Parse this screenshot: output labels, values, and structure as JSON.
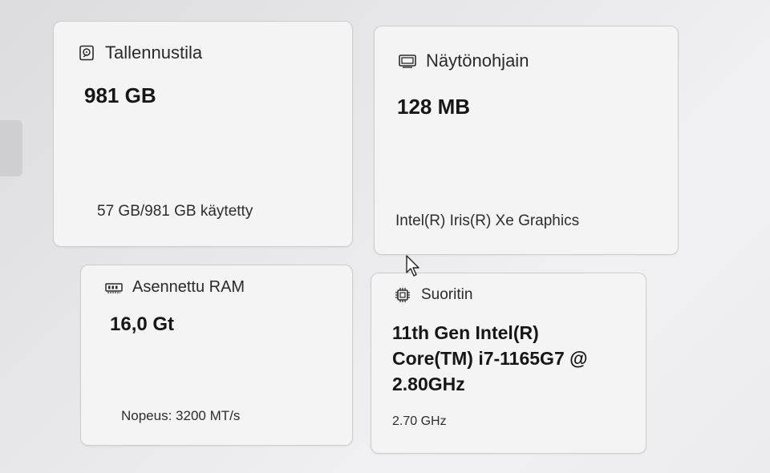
{
  "cards": {
    "storage": {
      "icon": "drive-icon",
      "title": "Tallennustila",
      "value": "981 GB",
      "detail": "57 GB/981 GB käytetty"
    },
    "gpu": {
      "icon": "display-adapter-icon",
      "title": "Näytönohjain",
      "value": "128 MB",
      "detail": "Intel(R) Iris(R) Xe Graphics"
    },
    "ram": {
      "icon": "ram-icon",
      "title": "Asennettu RAM",
      "value": "16,0 Gt",
      "detail": "Nopeus: 3200 MT/s"
    },
    "cpu": {
      "icon": "processor-icon",
      "title": "Suoritin",
      "value_lines": [
        "11th Gen Intel(R)",
        "Core(TM) i7-1165G7 @",
        "2.80GHz"
      ],
      "detail": "2.70 GHz"
    }
  }
}
